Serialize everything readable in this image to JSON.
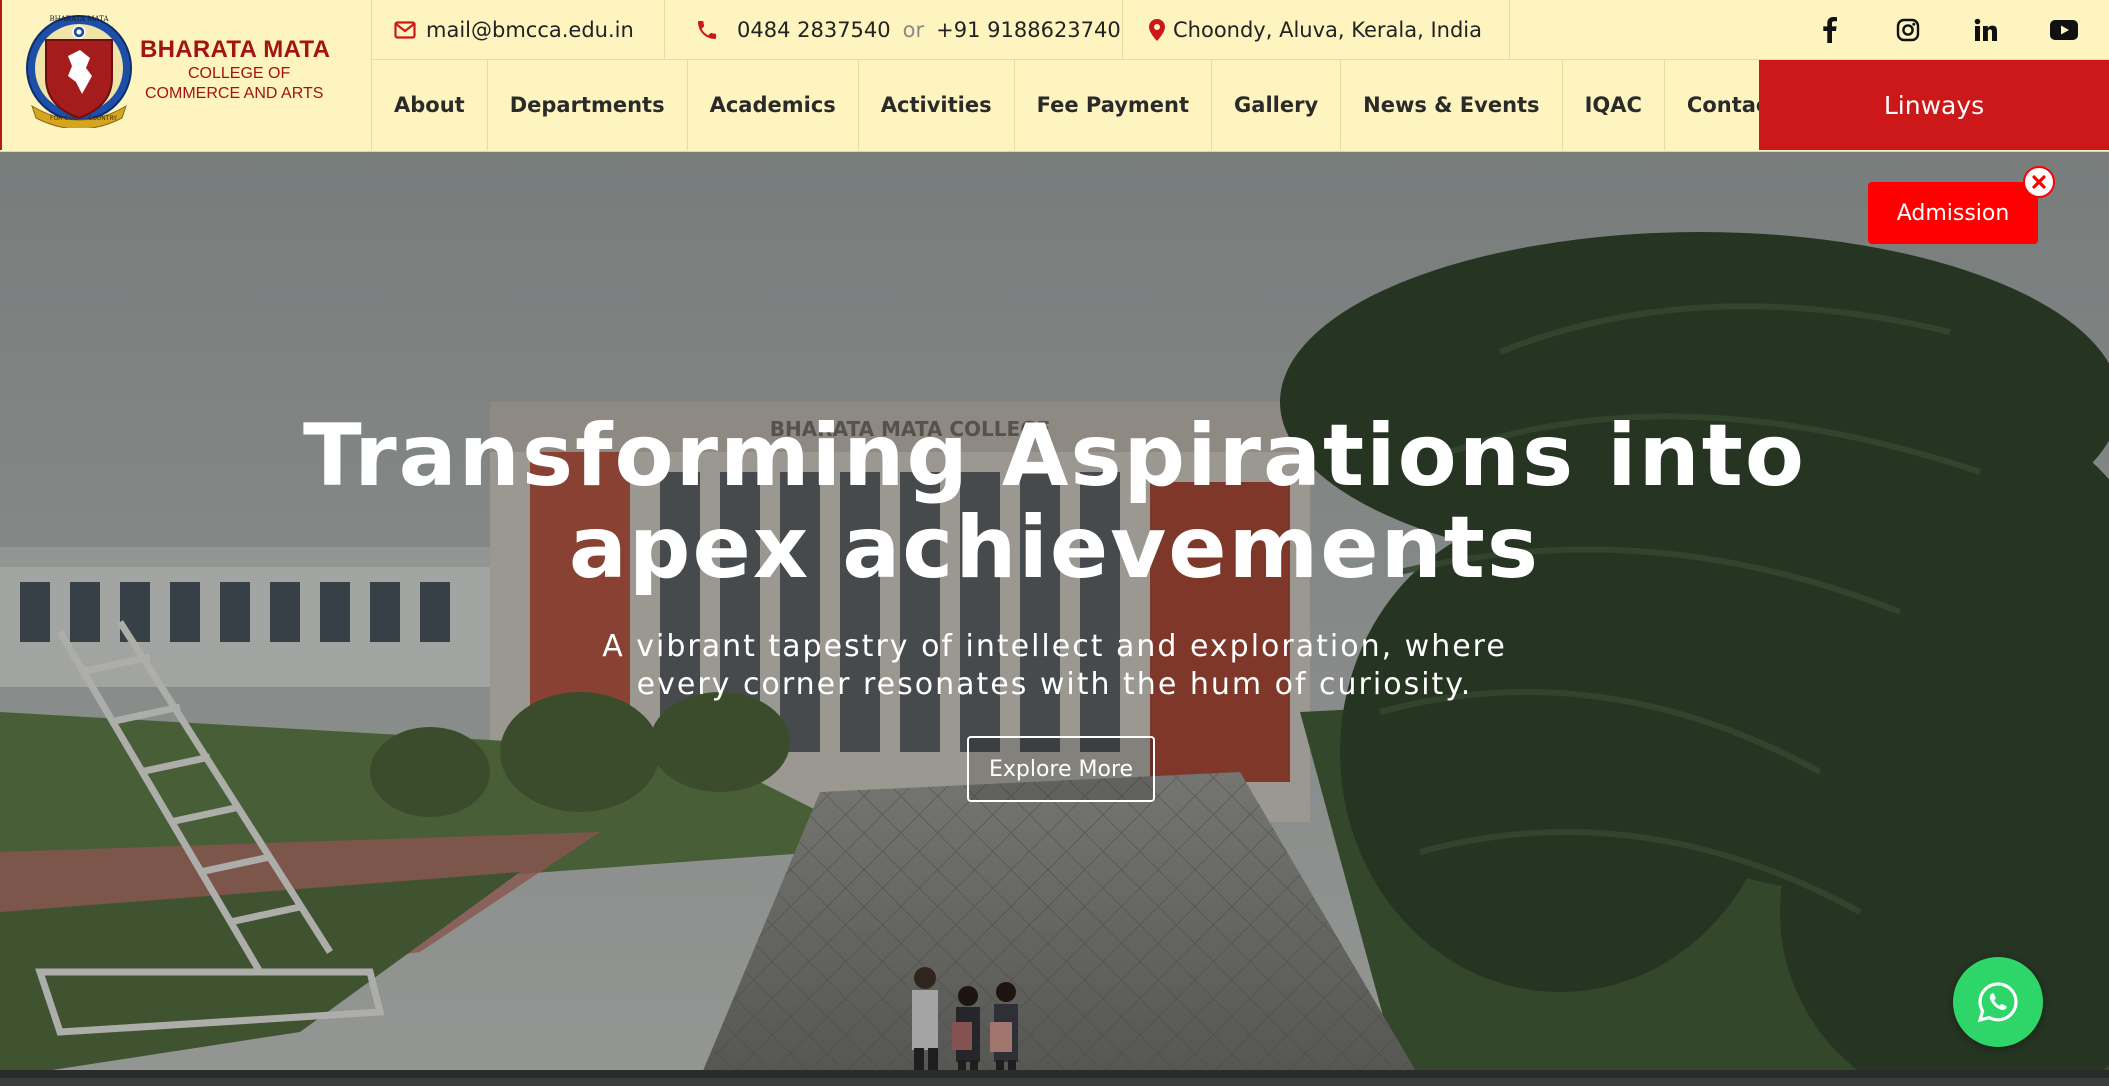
{
  "brand": {
    "title": "BHARATA MATA",
    "subtitle_line1": "COLLEGE OF",
    "subtitle_line2": "COMMERCE AND ARTS",
    "crest_arc_text": "BHARATA MATA",
    "crest_motto_left": "FOR GOD",
    "crest_motto_right": "COUNTRY"
  },
  "topbar": {
    "email": "mail@bmcca.edu.in",
    "phone_primary": "0484 2837540",
    "phone_separator": "or",
    "phone_secondary": "+91 9188623740",
    "address": "Choondy, Aluva, Kerala, India",
    "socials": [
      "facebook-icon",
      "instagram-icon",
      "linkedin-icon",
      "youtube-icon"
    ]
  },
  "nav": {
    "items": [
      {
        "label": "About"
      },
      {
        "label": "Departments"
      },
      {
        "label": "Academics"
      },
      {
        "label": "Activities"
      },
      {
        "label": "Fee Payment"
      },
      {
        "label": "Gallery"
      },
      {
        "label": "News & Events"
      },
      {
        "label": "IQAC"
      },
      {
        "label": "Contact"
      }
    ],
    "linways_label": "Linways"
  },
  "hero": {
    "title_line1": "Transforming Aspirations into",
    "title_line2": "apex achievements",
    "subtitle_line1": "A vibrant tapestry of intellect and exploration, where",
    "subtitle_line2": "every corner resonates with the hum of curiosity.",
    "button_label": "Explore More",
    "building_sign": "BHARATA MATA COLLEGE"
  },
  "floating": {
    "admission_label": "Admission",
    "close_icon": "close-icon",
    "whatsapp_icon": "whatsapp-icon"
  },
  "colors": {
    "header_bg": "#fdf4c0",
    "brand_red": "#a31313",
    "linways_red": "#cc1818",
    "admission_red": "#ff0000",
    "whatsapp_green": "#2ed66a"
  }
}
